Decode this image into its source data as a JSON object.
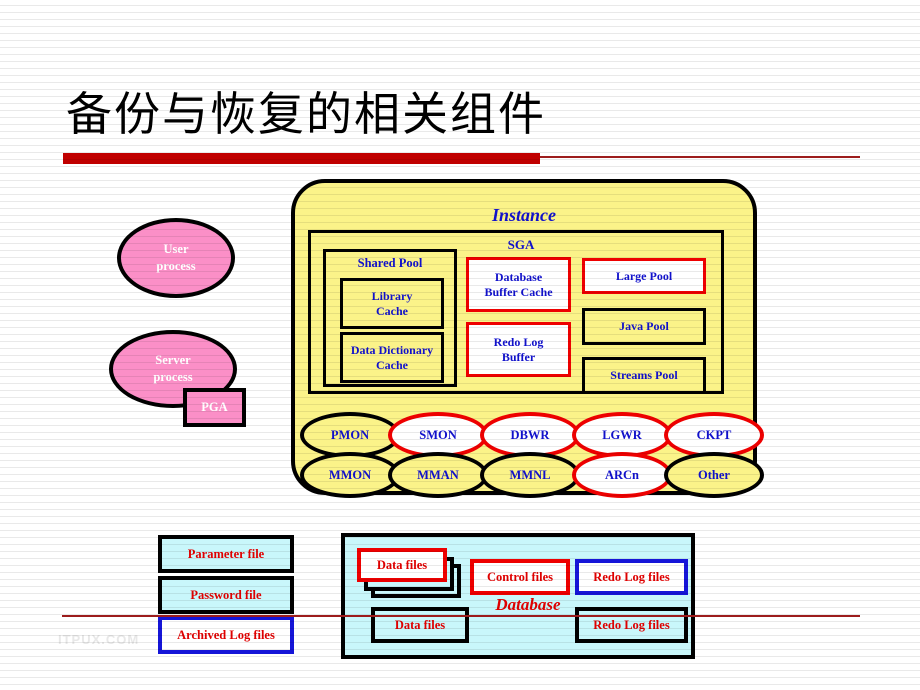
{
  "slide": {
    "title": "备份与恢复的相关组件",
    "watermark": "ITPUX.COM"
  },
  "colors": {
    "title_rule": "#c00000",
    "instance_fill": "#fbf389",
    "pink_fill": "#fb8fc7",
    "cyan_fill": "#c9f7fb",
    "blue_text": "#1111cc",
    "red_text": "#e00000",
    "red_border": "#ee0000",
    "blue_border": "#1515d8",
    "black_border": "#000000"
  },
  "client_side": {
    "user_process": "User\nprocess",
    "user_process_line1": "User",
    "user_process_line2": "process",
    "server_process_line1": "Server",
    "server_process_line2": "process",
    "pga": "PGA"
  },
  "instance": {
    "label": "Instance",
    "sga": {
      "label": "SGA",
      "shared_pool": {
        "label": "Shared Pool",
        "library_cache_line1": "Library",
        "library_cache_line2": "Cache",
        "data_dictionary_cache_line1": "Data  Dictionary",
        "data_dictionary_cache_line2": "Cache"
      },
      "database_buffer_cache_line1": "Database",
      "database_buffer_cache_line2": "Buffer Cache",
      "redo_log_buffer_line1": "Redo Log",
      "redo_log_buffer_line2": "Buffer",
      "large_pool": "Large Pool",
      "java_pool": "Java  Pool",
      "streams_pool": "Streams Pool"
    },
    "background_processes": [
      {
        "label": "PMON",
        "style": "black"
      },
      {
        "label": "SMON",
        "style": "red"
      },
      {
        "label": "DBWR",
        "style": "red"
      },
      {
        "label": "LGWR",
        "style": "red"
      },
      {
        "label": "CKPT",
        "style": "red"
      },
      {
        "label": "MMON",
        "style": "black"
      },
      {
        "label": "MMAN",
        "style": "black"
      },
      {
        "label": "MMNL",
        "style": "black"
      },
      {
        "label": "ARCn",
        "style": "red"
      },
      {
        "label": "Other",
        "style": "black"
      }
    ]
  },
  "files": {
    "parameter_file": "Parameter file",
    "password_file": "Password file",
    "archived_log_files": "Archived Log files"
  },
  "database": {
    "label": "Database",
    "data_files_front": "Data  files",
    "control_files": "Control files",
    "redo_log_files_top": "Redo  Log files",
    "data_files_bottom": "Data  files",
    "redo_log_files_bottom": "Redo  Log files"
  }
}
